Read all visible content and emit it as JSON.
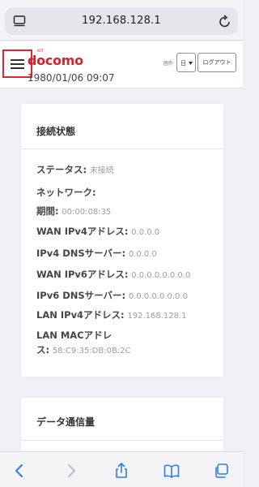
{
  "browser": {
    "url": "192.168.128.1"
  },
  "header": {
    "logo_small": "NTT",
    "logo_text": "docomo",
    "datetime": "1980/01/06 09:07",
    "area_label": "圏外",
    "language": "日",
    "logout_label": "ログアウト"
  },
  "status_card": {
    "title": "接続状態",
    "rows": [
      {
        "label": "ステータス:",
        "value": "未接続"
      },
      {
        "label": "ネットワーク:",
        "value": ""
      },
      {
        "label": "期間:",
        "value": "00:00:08:35"
      },
      {
        "label": "WAN IPv4アドレス:",
        "value": "0.0.0.0"
      },
      {
        "label": "IPv4 DNSサーバー:",
        "value": "0.0.0.0"
      },
      {
        "label": "WAN IPv6アドレス:",
        "value": "0.0.0.0.0.0.0.0"
      },
      {
        "label": "IPv6 DNSサーバー:",
        "value": "0.0.0.0.0.0.0.0"
      },
      {
        "label": "LAN IPv4アドレス:",
        "value": "192.168.128.1"
      },
      {
        "label": "LAN MACアドレ",
        "label2": "ス:",
        "value": "58:C9:35:DB:0B:2C"
      }
    ]
  },
  "data_card": {
    "title": "データ通信量"
  },
  "toolbar": {
    "icons": [
      "back-icon",
      "forward-icon",
      "share-icon",
      "bookmarks-icon",
      "tabs-icon"
    ]
  },
  "colors": {
    "brand": "#d4232a",
    "highlight_border": "#e3262b",
    "ios_blue": "#2f7bf5"
  }
}
